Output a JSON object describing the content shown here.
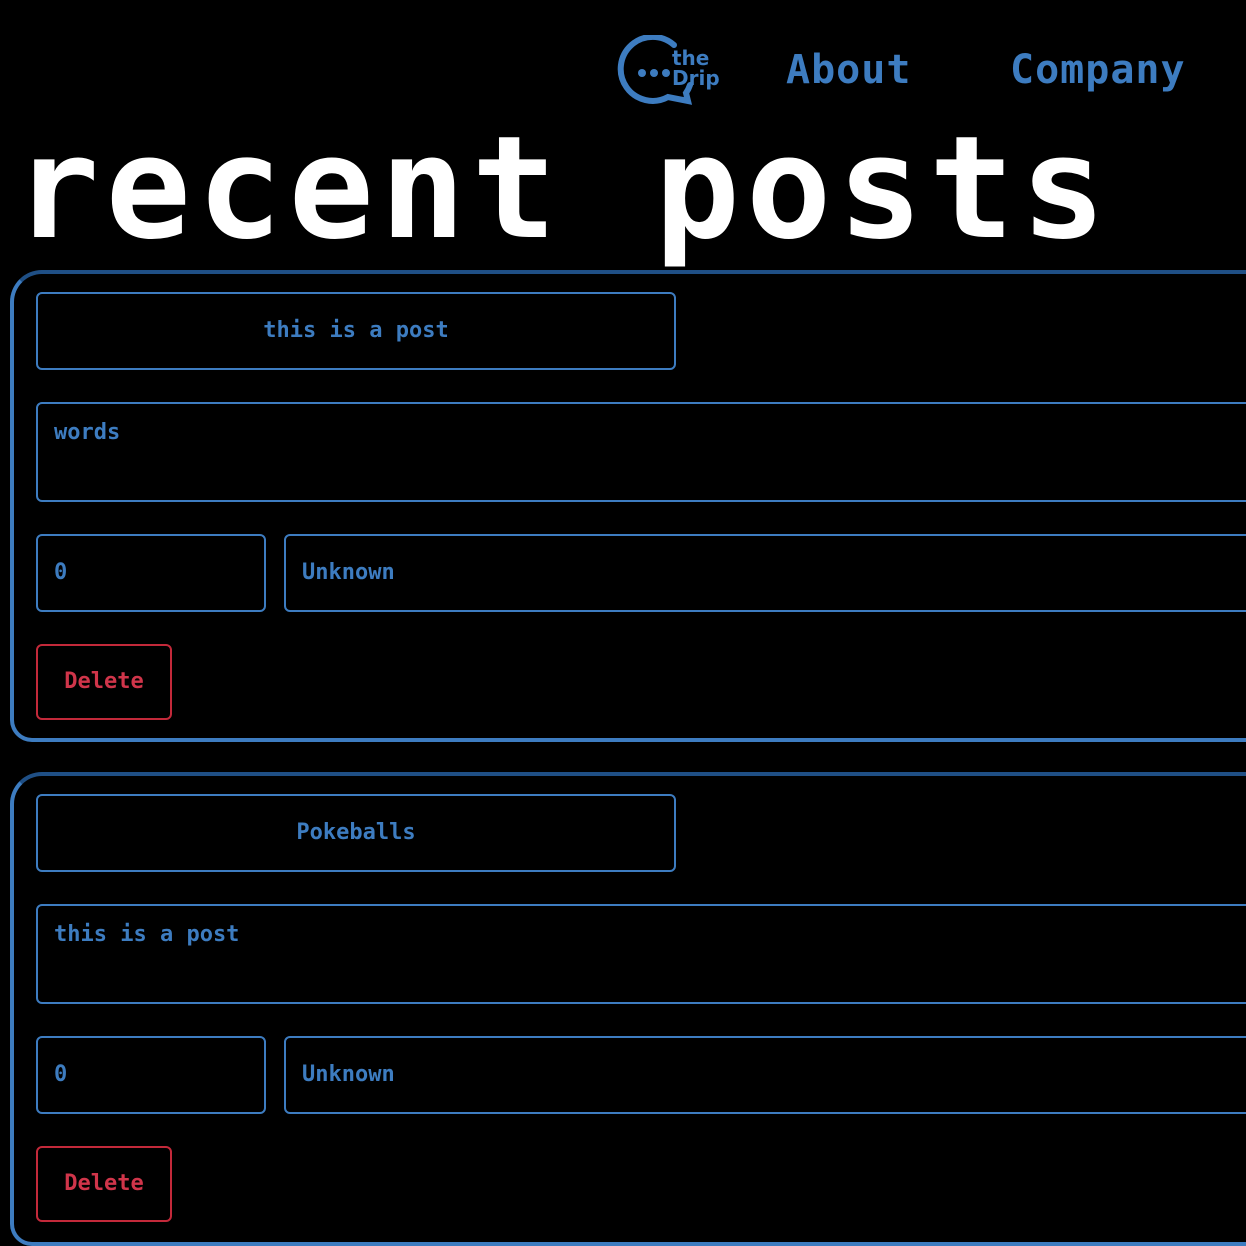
{
  "header": {
    "logo": {
      "line1": "the",
      "line2": "Drip",
      "icon": "speech-bubble-icon",
      "color": "#3d7cc0"
    },
    "nav": [
      {
        "label": "About"
      },
      {
        "label": "Company"
      }
    ]
  },
  "page": {
    "title": "recent posts"
  },
  "posts": [
    {
      "title": "this is a post",
      "body": "words",
      "count": "0",
      "author": "Unknown",
      "delete_label": "Delete"
    },
    {
      "title": "Pokeballs",
      "body": "this is a post",
      "count": "0",
      "author": "Unknown",
      "delete_label": "Delete"
    }
  ],
  "colors": {
    "background": "#000000",
    "accent": "#3d7cc0",
    "danger": "#d0354a",
    "title": "#ffffff"
  }
}
